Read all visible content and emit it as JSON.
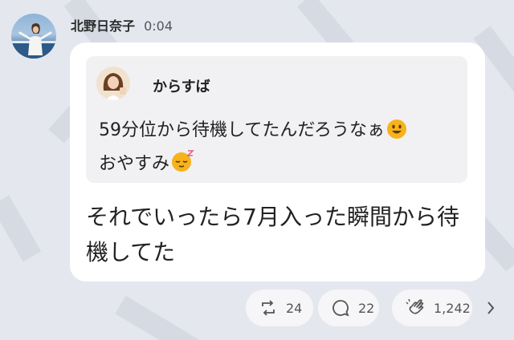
{
  "post": {
    "author": "北野日奈子",
    "time": "0:04",
    "message": "それでいったら7月入った瞬間から待機してた"
  },
  "quoted": {
    "author": "からすば",
    "text_line1": "59分位から待機してたんだろうなぁ",
    "text_line2": "おやすみ",
    "emojis": [
      "grinning-face-icon",
      "sleeping-face-icon"
    ]
  },
  "actions": {
    "repost_count": "24",
    "comment_count": "22",
    "clap_count": "1,242"
  },
  "icons": [
    "repost-icon",
    "comment-icon",
    "clap-icon",
    "chevron-right-icon"
  ],
  "colors": {
    "background": "#e4e7ee",
    "card": "#ffffff",
    "quote_card": "#f1f1f3",
    "action_pill": "#f6f6f8",
    "emoji_yellow": "#f7b21c"
  }
}
